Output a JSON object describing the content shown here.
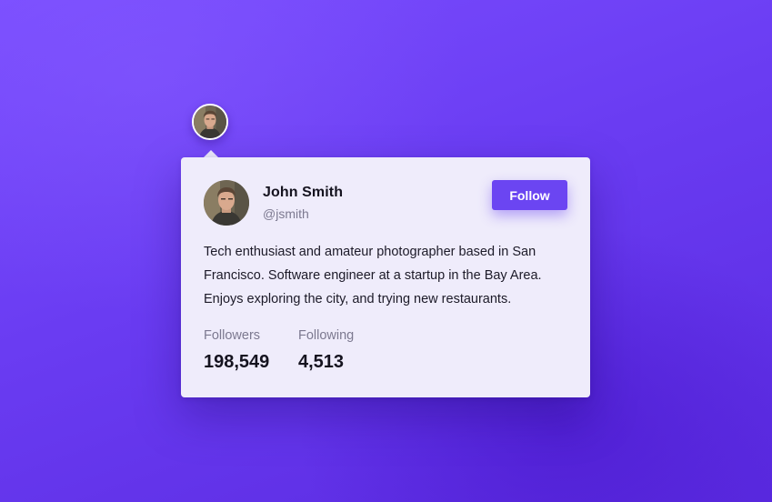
{
  "profile": {
    "name": "John Smith",
    "handle": "@jsmith",
    "bio": "Tech enthusiast and amateur photographer based in San Francisco. Software engineer at a startup in the Bay Area. Enjoys exploring the city, and trying new restaurants.",
    "avatar_icon": "user-photo"
  },
  "actions": {
    "follow_label": "Follow"
  },
  "stats": {
    "followers_label": "Followers",
    "followers_value": "198,549",
    "following_label": "Following",
    "following_value": "4,513"
  },
  "colors": {
    "accent": "#6b45f2",
    "card_background": "#efecfb",
    "page_background": "#7248f7"
  }
}
